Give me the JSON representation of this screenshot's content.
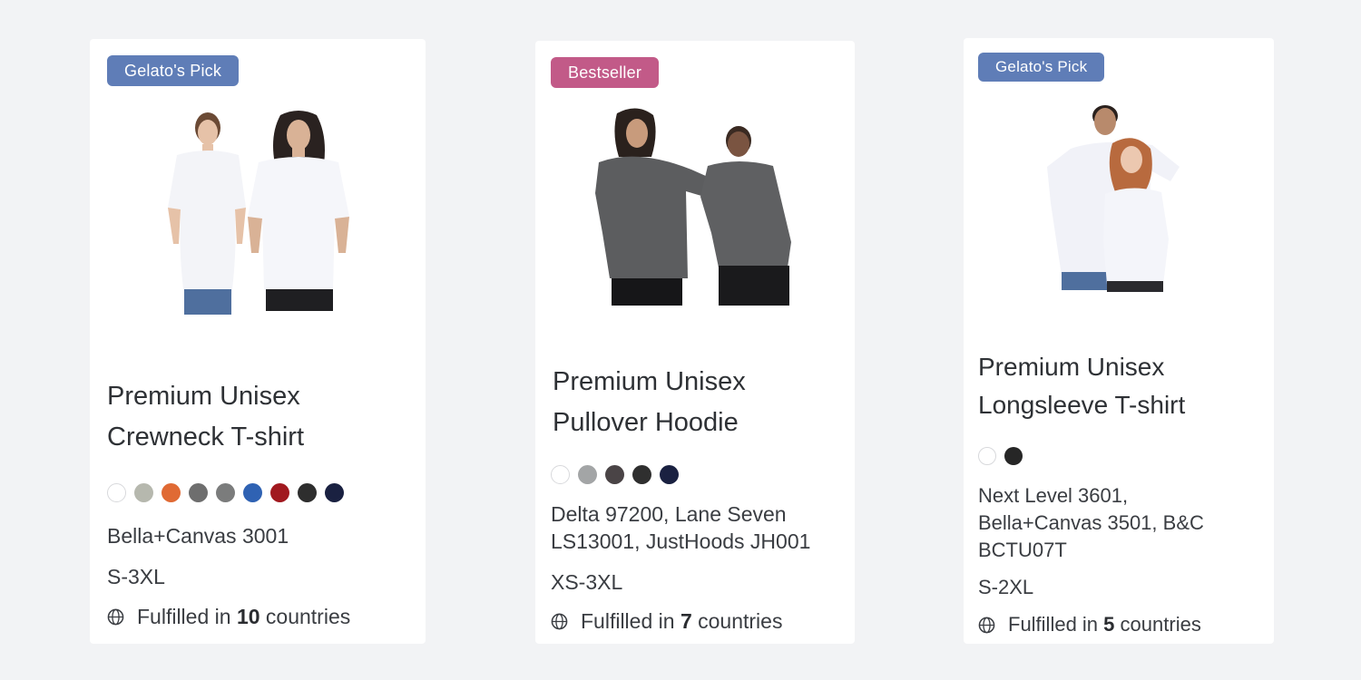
{
  "cards": [
    {
      "badge": "Gelato's Pick",
      "badge_color": "#5f7db7",
      "title_line1": "Premium Unisex",
      "title_line2": "Crewneck T-shirt",
      "image_subject": "two models wearing white crewneck t-shirts",
      "swatches": [
        "#ffffff",
        "#b6b8ae",
        "#e06a34",
        "#6e6e6e",
        "#7b7c7c",
        "#2f62b3",
        "#a1191f",
        "#2e2e2e",
        "#1a2141"
      ],
      "models_line1": "Bella+Canvas 3001",
      "models_line2": "",
      "models_line3": "",
      "sizes": "S-3XL",
      "fulfilled_prefix": "Fulfilled in",
      "fulfilled_count": "10",
      "fulfilled_suffix": "countries"
    },
    {
      "badge": "Bestseller",
      "badge_color": "#c25a88",
      "title_line1": "Premium Unisex",
      "title_line2": "Pullover Hoodie",
      "image_subject": "two models wearing grey pullover hoodies",
      "swatches": [
        "#ffffff",
        "#a3a5a6",
        "#4a4446",
        "#2f2f2f",
        "#1a2141"
      ],
      "models_line1": "Delta 97200, Lane Seven",
      "models_line2": "LS13001, JustHoods JH001",
      "models_line3": "",
      "sizes": "XS-3XL",
      "fulfilled_prefix": "Fulfilled in",
      "fulfilled_count": "7",
      "fulfilled_suffix": "countries"
    },
    {
      "badge": "Gelato's Pick",
      "badge_color": "#5f7db7",
      "title_line1": "Premium Unisex",
      "title_line2": "Longsleeve T-shirt",
      "image_subject": "two models wearing white longsleeve t-shirts",
      "swatches": [
        "#ffffff",
        "#262626"
      ],
      "models_line1": "Next Level 3601,",
      "models_line2": "Bella+Canvas 3501, B&C",
      "models_line3": "BCTU07T",
      "sizes": "S-2XL",
      "fulfilled_prefix": "Fulfilled in",
      "fulfilled_count": "5",
      "fulfilled_suffix": "countries"
    }
  ]
}
